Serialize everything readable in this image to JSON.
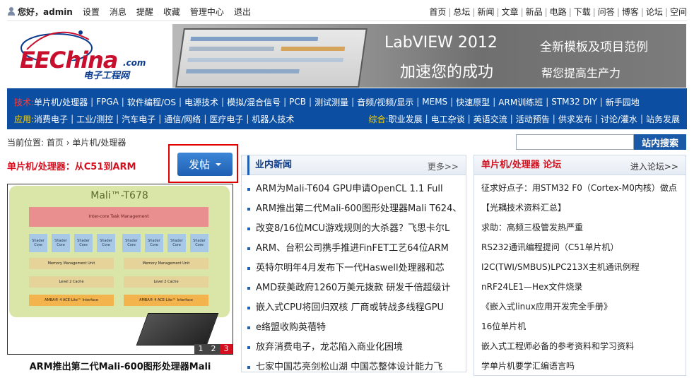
{
  "topbar": {
    "greeting": "您好，admin",
    "links": [
      "设置",
      "消息",
      "提醒",
      "收藏",
      "管理中心",
      "退出"
    ],
    "nav": [
      "首页",
      "总坛",
      "新闻",
      "文章",
      "新品",
      "电路",
      "下载",
      "问答",
      "博客",
      "论坛",
      "空间"
    ]
  },
  "logo": {
    "brand": "EEChina",
    "dotcom": ".com",
    "cn": "电子工程网"
  },
  "banner": {
    "title": "LabVIEW 2012",
    "subtitle": "全新模板及项目范例",
    "tagline": "加速您的成功",
    "tagline2": "帮您提高生产力"
  },
  "nav": {
    "tech_label": "技术:",
    "tech": [
      "单片机/处理器",
      "FPGA",
      "软件编程/OS",
      "电源技术",
      "模拟/混合信号",
      "PCB",
      "测试测量",
      "音频/视频/显示",
      "MEMS",
      "快速原型",
      "ARM训练班",
      "STM32 DIY",
      "新手园地"
    ],
    "app_label": "应用:",
    "apps": [
      "消费电子",
      "工业/测控",
      "汽车电子",
      "通信/网络",
      "医疗电子",
      "机器人技术"
    ],
    "general_label": "综合:",
    "general": [
      "职业发展",
      "电工杂谈",
      "英语交流",
      "活动预告",
      "供求发布",
      "讨论/灌水",
      "站务发展"
    ]
  },
  "breadcrumb": {
    "prefix": "当前位置:",
    "home": "首页",
    "sep": "›",
    "current": "单片机/处理器"
  },
  "search": {
    "placeholder": "",
    "button": "站内搜索"
  },
  "section": {
    "title": "单片机/处理器：从C51到ARM",
    "post_button": "发帖"
  },
  "slideshow": {
    "chip_title": "Mali™-T678",
    "chip_bar": "Inter-core Task Management",
    "core_label": "Shader Core",
    "mmu": "Memory Management Unit",
    "l2": "Level 2 Cache",
    "amba": "AMBA® 4 ACE-Lite™ Interface",
    "pages": [
      "1",
      "2",
      "3"
    ],
    "active_page": "3",
    "caption": "ARM推出第二代Mali-600图形处理器Mali"
  },
  "industry_news": {
    "title": "业内新闻",
    "more": "更多>>",
    "items": [
      "ARM为Mali-T604 GPU申请OpenCL 1.1 Full",
      "ARM推出第二代Mali-600图形处理器Mali T624、",
      "改变8/16位MCU游戏规则的大杀器？飞思卡尔L",
      "ARM、台积公司携手推进FinFET工艺64位ARM",
      "英特尔明年4月发布下一代Haswell处理器和芯",
      "AMD获美政府1260万美元拨款 研发千倍超级计",
      "嵌入式CPU将回归双核 厂商或转战多线程GPU",
      "e络盟收购英蓓特",
      "放弃消费电子，龙芯陷入商业化困境",
      "七家中国芯亮剑松山湖 中国芯整体设计能力飞"
    ]
  },
  "forum": {
    "title": "单片机/处理器 论坛",
    "enter": "进入论坛>>",
    "items": [
      "征求好点子：用STM32 F0（Cortex-M0内核）做点",
      "【光耦技术资料汇总】",
      "求助：高频三极管发热严重",
      "RS232通讯编程提问（C51单片机）",
      "I2C(TWI/SMBUS)LPC213X主机通讯例程",
      "nRF24LE1—Hex文件烧录",
      "《嵌入式linux应用开发完全手册》",
      "16位单片机",
      "嵌入式工程师必备的参考资料和学习资料",
      "学单片机要学汇编语言吗"
    ]
  },
  "colors": {
    "nav_blue": "#0b4ea2",
    "accent_red": "#d4101e",
    "link_blue": "#0b3a86"
  }
}
